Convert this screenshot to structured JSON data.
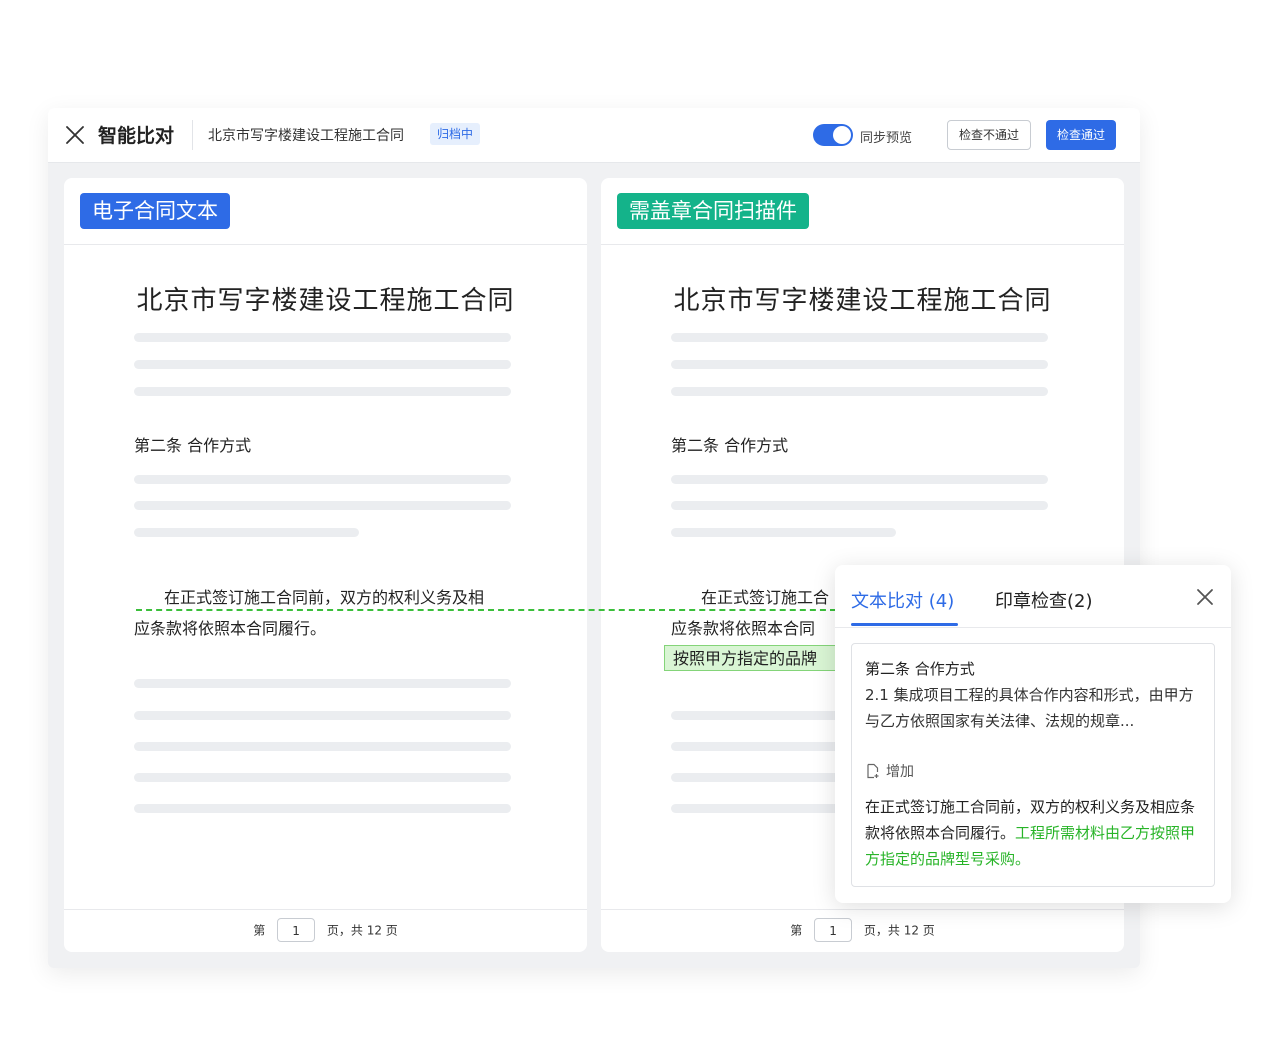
{
  "header": {
    "app_title": "智能比对",
    "doc_name": "北京市写字楼建设工程施工合同",
    "status_badge": "归档中",
    "sync_label": "同步预览",
    "sync_on": true,
    "fail_button": "检查不通过",
    "pass_button": "检查通过"
  },
  "left_panel": {
    "tag": "电子合同文本",
    "title": "北京市写字楼建设工程施工合同",
    "section": "第二条  合作方式",
    "para_line1": "在正式签订施工合同前，双方的权利义务及相",
    "para_line2": "应条款将依照本合同履行。",
    "pager": {
      "prefix": "第",
      "page": "1",
      "suffix": "页，共 12 页"
    }
  },
  "right_panel": {
    "tag": "需盖章合同扫描件",
    "title": "北京市写字楼建设工程施工合同",
    "section": "第二条  合作方式",
    "para_line1": "在正式签订施工合",
    "para_line2": "应条款将依照本合同",
    "highlight": "按照甲方指定的品牌",
    "pager": {
      "prefix": "第",
      "page": "1",
      "suffix": "页，共 12 页"
    }
  },
  "popup": {
    "tab_text_compare": "文本比对 (4)",
    "tab_seal_check": "印章检查(2)",
    "card": {
      "section": "第二条  合作方式",
      "description": "2.1  集成项目工程的具体合作内容和形式，由甲方与乙方依照国家有关法律、法规的规章...",
      "change_type": "增加",
      "text_normal": "在正式签订施工合同前，双方的权利义务及相应条款将依照本合同履行。",
      "text_added": "工程所需材料由乙方按照甲方指定的品牌型号采购。"
    }
  },
  "colors": {
    "primary": "#2e6be6",
    "accent_green": "#14b38a",
    "added_text": "#28b428",
    "highlight_bg": "#d9f5d4"
  }
}
